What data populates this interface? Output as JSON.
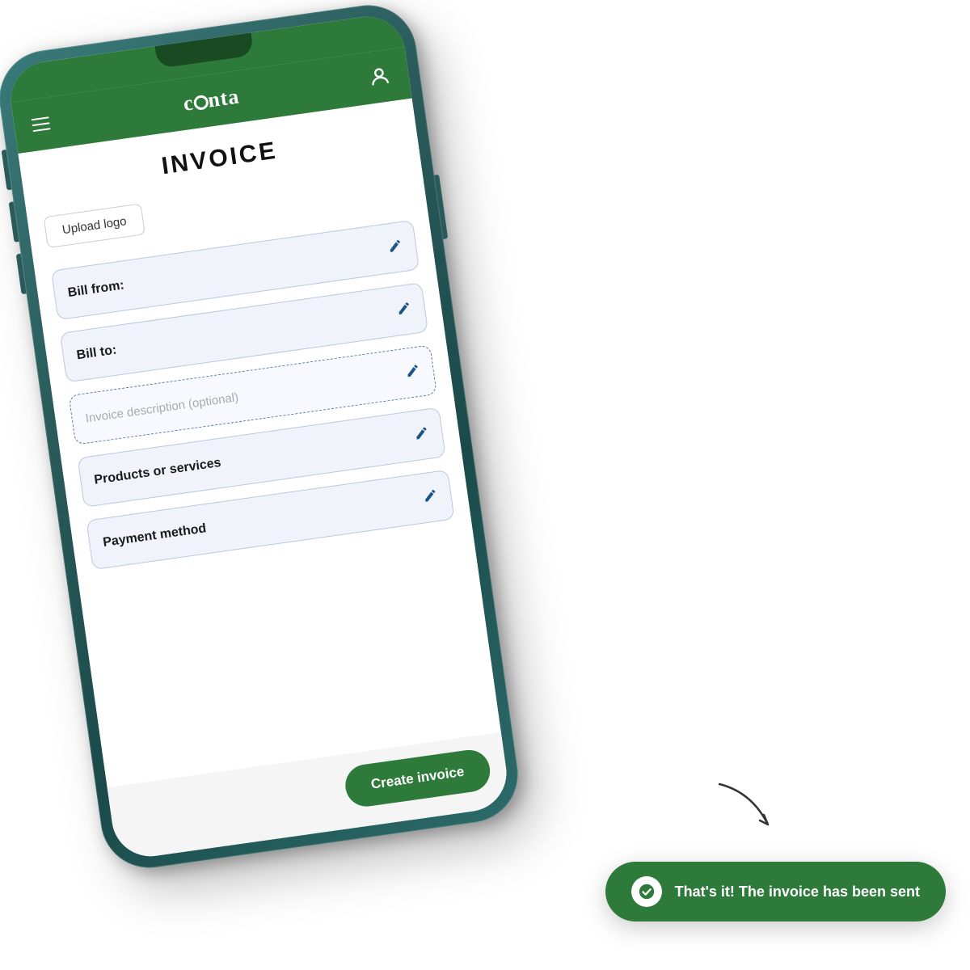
{
  "app": {
    "name": "conta",
    "header_menu_icon": "hamburger",
    "user_icon": "user"
  },
  "invoice_screen": {
    "title": "INVOICE",
    "upload_logo_label": "Upload logo",
    "fields": [
      {
        "id": "bill-from",
        "label": "Bill from:",
        "placeholder": "",
        "type": "solid"
      },
      {
        "id": "bill-to",
        "label": "Bill to:",
        "placeholder": "",
        "type": "solid"
      },
      {
        "id": "invoice-description",
        "label": "Invoice description (optional)",
        "placeholder": "Invoice description (optional)",
        "type": "dashed"
      },
      {
        "id": "products-services",
        "label": "Products or services",
        "placeholder": "",
        "type": "solid"
      },
      {
        "id": "payment-method",
        "label": "Payment method",
        "placeholder": "",
        "type": "solid"
      }
    ],
    "create_button_label": "Create invoice"
  },
  "toast": {
    "message": "That's it! The invoice has been sent",
    "icon": "check-circle"
  },
  "colors": {
    "brand_green": "#2d7a3a",
    "brand_blue": "#1a5588",
    "field_bg": "#f0f4fa",
    "field_border": "#b8c9e0"
  }
}
